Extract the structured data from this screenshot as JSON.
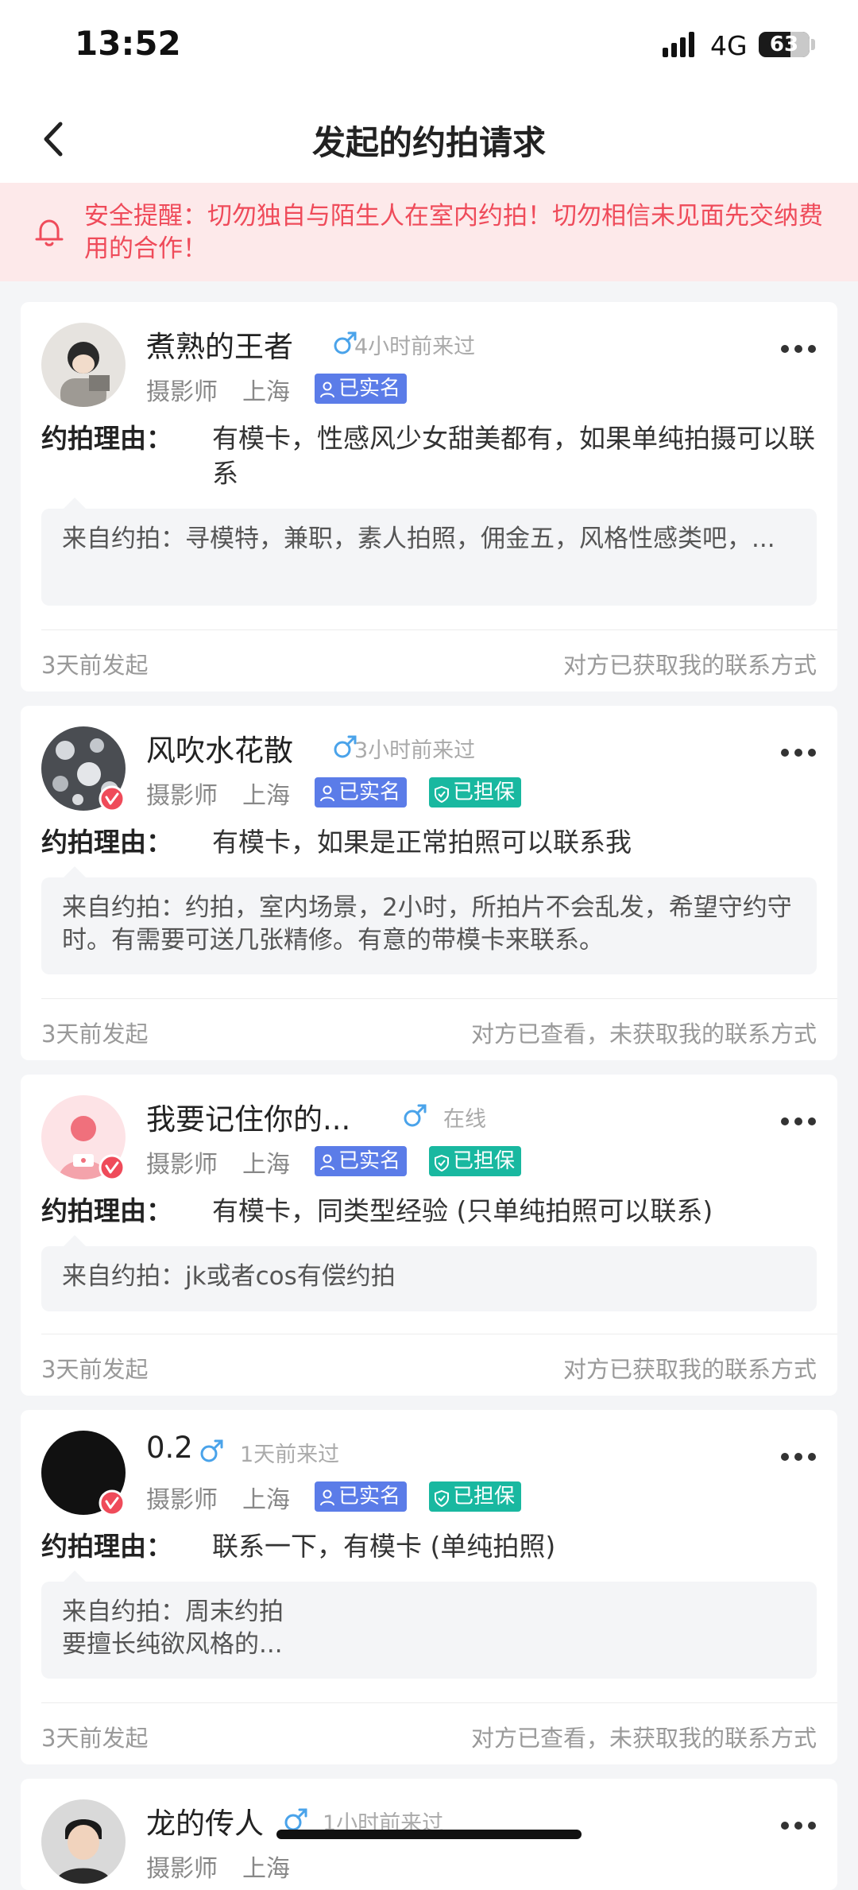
{
  "status_bar": {
    "time": "13:52",
    "network": "4G",
    "battery": "63"
  },
  "nav": {
    "back_icon": "chevron-left-icon",
    "title": "发起的约拍请求"
  },
  "notice": {
    "icon": "bell-icon",
    "text": "安全提醒：切勿独自与陌生人在室内约拍！切勿相信未见面先交纳费用的合作！"
  },
  "labels": {
    "reason": "约拍理由："
  },
  "colors": {
    "accent_blue": "#5b7ce8",
    "accent_teal": "#19b8a0",
    "warning_red": "#ef4b5a",
    "gender_blue": "#4aa3ea"
  },
  "cards": [
    {
      "name": "煮熟的王者",
      "gender_icon": "male-icon",
      "active": "4小时前来过",
      "role": "摄影师",
      "city": "上海",
      "tag_real": "已实名",
      "reason": "有模卡，性感风少女甜美都有，如果单纯拍摄可以联系",
      "quote": "来自约拍：寻模特，兼职，素人拍照，佣金五，风格性感类吧，...",
      "sent": "3天前发起",
      "status": "对方已获取我的联系方式"
    },
    {
      "name": "风吹水花散",
      "gender_icon": "male-icon",
      "active": "3小时前来过",
      "role": "摄影师",
      "city": "上海",
      "tag_real": "已实名",
      "tag_guarantee": "已担保",
      "reason": "有模卡，如果是正常拍照可以联系我",
      "quote": "来自约拍：约拍，室内场景，2小时，所拍片不会乱发，希望守约守时。有需要可送几张精修。有意的带模卡来联系。",
      "sent": "3天前发起",
      "status": "对方已查看，未获取我的联系方式"
    },
    {
      "name": "我要记住你的...",
      "gender_icon": "male-icon",
      "active": "在线",
      "role": "摄影师",
      "city": "上海",
      "tag_real": "已实名",
      "tag_guarantee": "已担保",
      "reason": "有模卡，同类型经验 (只单纯拍照可以联系)",
      "quote": "来自约拍：jk或者cos有偿约拍",
      "sent": "3天前发起",
      "status": "对方已获取我的联系方式"
    },
    {
      "name": "0.2",
      "gender_icon": "male-icon",
      "active": "1天前来过",
      "role": "摄影师",
      "city": "上海",
      "tag_real": "已实名",
      "tag_guarantee": "已担保",
      "reason": "联系一下，有模卡 (单纯拍照)",
      "quote_line1": "来自约拍：周末约拍",
      "quote_line2": "要擅长纯欲风格的...",
      "sent": "3天前发起",
      "status": "对方已查看，未获取我的联系方式"
    },
    {
      "name": "龙的传人",
      "gender_icon": "male-icon",
      "active": "1小时前来过",
      "role": "摄影师",
      "city": "上海"
    }
  ]
}
